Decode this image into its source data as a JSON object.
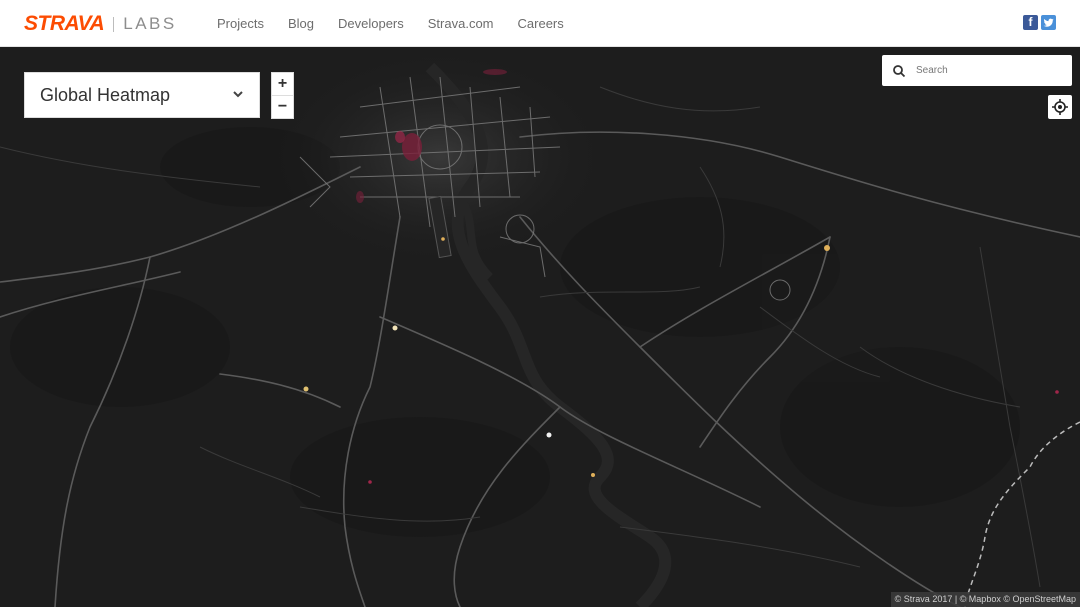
{
  "header": {
    "brand": "STRAVA",
    "subbrand": "LABS",
    "nav": [
      "Projects",
      "Blog",
      "Developers",
      "Strava.com",
      "Careers"
    ],
    "social": [
      {
        "name": "facebook-icon",
        "glyph": "f",
        "color": "#3b5998"
      },
      {
        "name": "twitter-icon",
        "glyph": "t",
        "color": "#4a90d9"
      }
    ]
  },
  "map_controls": {
    "layer_label": "Global Heatmap",
    "zoom_in": "+",
    "zoom_out": "−",
    "search_placeholder": "Search"
  },
  "attribution": "© Strava 2017 | © Mapbox © OpenStreetMap",
  "colors": {
    "brand": "#fc4c02",
    "map_background": "#1d1d1d",
    "road": "#5a5a5a",
    "heat_red": "#7a1f3a",
    "heat_yellow": "#e0b05a"
  }
}
